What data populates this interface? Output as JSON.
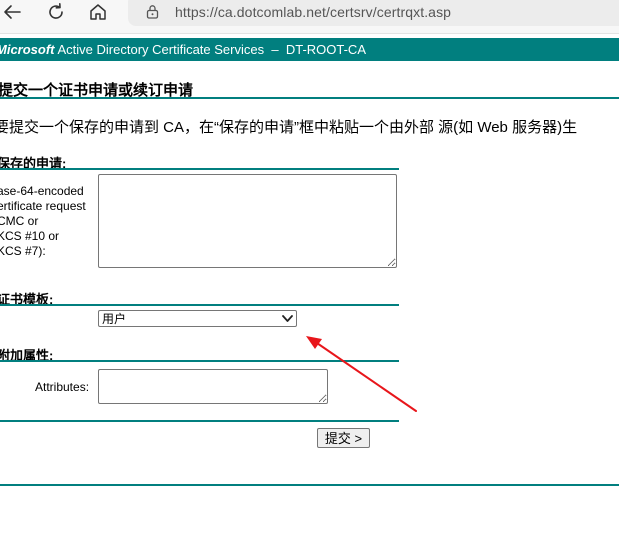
{
  "browser": {
    "url": "https://ca.dotcomlab.net/certsrv/certrqxt.asp",
    "back_icon": "arrow-left-icon",
    "refresh_icon": "refresh-icon",
    "home_icon": "home-icon",
    "lock_icon": "lock-icon"
  },
  "banner": {
    "brand": "Microsoft",
    "product": "Active Directory Certificate Services",
    "separator": "–",
    "ca_name": "DT-ROOT-CA",
    "color": "#017f7f"
  },
  "page": {
    "title": "提交一个证书申请或续订申请",
    "intro": "要提交一个保存的申请到 CA，在“保存的申请”框中粘贴一个由外部 源(如 Web 服务器)生"
  },
  "saved_request": {
    "section_label": "保存的申请:",
    "field_label_lines": [
      "ase-64-encoded",
      "ertificate request",
      "CMC or",
      "KCS #10 or",
      "KCS #7):"
    ],
    "value": ""
  },
  "template": {
    "section_label": "证书模板:",
    "selected": "用户"
  },
  "attributes": {
    "section_label": "附加属性:",
    "field_label": "Attributes:",
    "value": ""
  },
  "actions": {
    "submit_label": "提交 >"
  },
  "annotation": {
    "arrow_color": "#e8161b"
  }
}
